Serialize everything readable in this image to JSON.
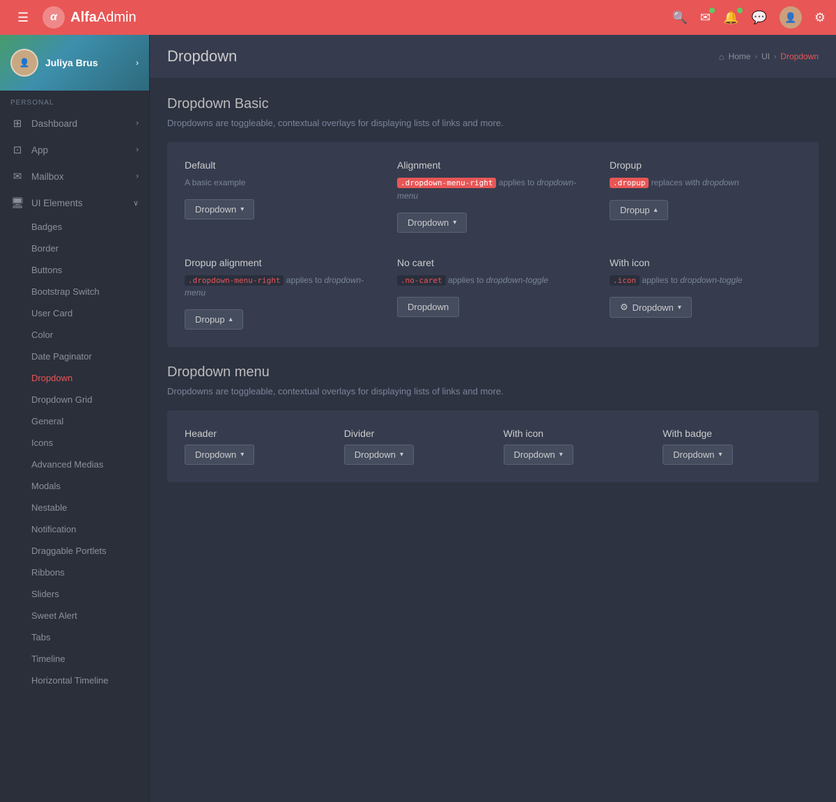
{
  "navbar": {
    "brand": "AlfaAdmin",
    "brand_bold": "Alfa",
    "brand_rest": "Admin",
    "hamburger_label": "☰",
    "icons": {
      "search": "🔍",
      "mail": "✉",
      "bell": "🔔",
      "chat": "💬",
      "settings": "⚙"
    }
  },
  "sidebar": {
    "user": {
      "name": "Juliya Brus"
    },
    "section_label": "PERSONAL",
    "menu_items": [
      {
        "id": "dashboard",
        "label": "Dashboard",
        "icon": "⊞",
        "has_arrow": true
      },
      {
        "id": "app",
        "label": "App",
        "icon": "⊡",
        "has_arrow": true
      },
      {
        "id": "mailbox",
        "label": "Mailbox",
        "icon": "✉",
        "has_arrow": true
      },
      {
        "id": "ui-elements",
        "label": "UI Elements",
        "icon": "🖥",
        "has_arrow": true,
        "expanded": true
      }
    ],
    "sub_items": [
      {
        "id": "badges",
        "label": "Badges"
      },
      {
        "id": "border",
        "label": "Border"
      },
      {
        "id": "buttons",
        "label": "Buttons"
      },
      {
        "id": "bootstrap-switch",
        "label": "Bootstrap Switch"
      },
      {
        "id": "user-card",
        "label": "User Card"
      },
      {
        "id": "color",
        "label": "Color"
      },
      {
        "id": "date-paginator",
        "label": "Date Paginator"
      },
      {
        "id": "dropdown",
        "label": "Dropdown",
        "active": true
      },
      {
        "id": "dropdown-grid",
        "label": "Dropdown Grid"
      },
      {
        "id": "general",
        "label": "General"
      },
      {
        "id": "icons",
        "label": "Icons"
      },
      {
        "id": "advanced-medias",
        "label": "Advanced Medias"
      },
      {
        "id": "modals",
        "label": "Modals"
      },
      {
        "id": "nestable",
        "label": "Nestable"
      },
      {
        "id": "notification",
        "label": "Notification"
      },
      {
        "id": "draggable-portlets",
        "label": "Draggable Portlets"
      },
      {
        "id": "ribbons",
        "label": "Ribbons"
      },
      {
        "id": "sliders",
        "label": "Sliders"
      },
      {
        "id": "sweet-alert",
        "label": "Sweet Alert"
      },
      {
        "id": "tabs",
        "label": "Tabs"
      },
      {
        "id": "timeline",
        "label": "Timeline"
      },
      {
        "id": "horizontal-timeline",
        "label": "Horizontal Timeline"
      }
    ]
  },
  "page": {
    "title": "Dropdown",
    "breadcrumb": {
      "home": "Home",
      "section": "UI",
      "current": "Dropdown"
    }
  },
  "dropdown_basic": {
    "section_title": "Dropdown Basic",
    "section_desc": "Dropdowns are toggleable, contextual overlays for displaying lists of links and more.",
    "items": [
      {
        "id": "default",
        "title": "Default",
        "desc_plain": "A basic example",
        "desc_parts": [],
        "button_label": "Dropdown",
        "has_icon": false
      },
      {
        "id": "alignment",
        "title": "Alignment",
        "desc_code": ".dropdown-menu-right",
        "desc_rest": " applies to ",
        "desc_italic": "dropdown-menu",
        "button_label": "Dropdown",
        "has_icon": false
      },
      {
        "id": "dropup",
        "title": "Dropup",
        "desc_code": ".dropup",
        "desc_rest": " replaces with ",
        "desc_italic": "dropdown",
        "button_label": "Dropup",
        "has_icon": false
      },
      {
        "id": "dropup-alignment",
        "title": "Dropup alignment",
        "desc_code": ".dropdown-menu-right",
        "desc_rest": " applies to ",
        "desc_italic": "dropdown-menu",
        "button_label": "Dropup",
        "has_icon": false
      },
      {
        "id": "no-caret",
        "title": "No caret",
        "desc_code": ".no-caret",
        "desc_rest": " applies to ",
        "desc_italic": "dropdown-toggle",
        "button_label": "Dropdown",
        "has_icon": false,
        "no_caret": true
      },
      {
        "id": "with-icon",
        "title": "With icon",
        "desc_code": ".icon",
        "desc_rest": " applies to ",
        "desc_italic": "dropdown-toggle",
        "button_label": "Dropdown",
        "has_icon": true
      }
    ]
  },
  "dropdown_menu": {
    "section_title": "Dropdown menu",
    "section_desc": "Dropdowns are toggleable, contextual overlays for displaying lists of links and more.",
    "items": [
      {
        "id": "header",
        "title": "Header",
        "button_label": "Dropdown"
      },
      {
        "id": "divider",
        "title": "Divider",
        "button_label": "Dropdown"
      },
      {
        "id": "with-icon",
        "title": "With icon",
        "button_label": "Dropdown"
      },
      {
        "id": "with-badge",
        "title": "With badge",
        "button_label": "Dropdown"
      }
    ]
  }
}
